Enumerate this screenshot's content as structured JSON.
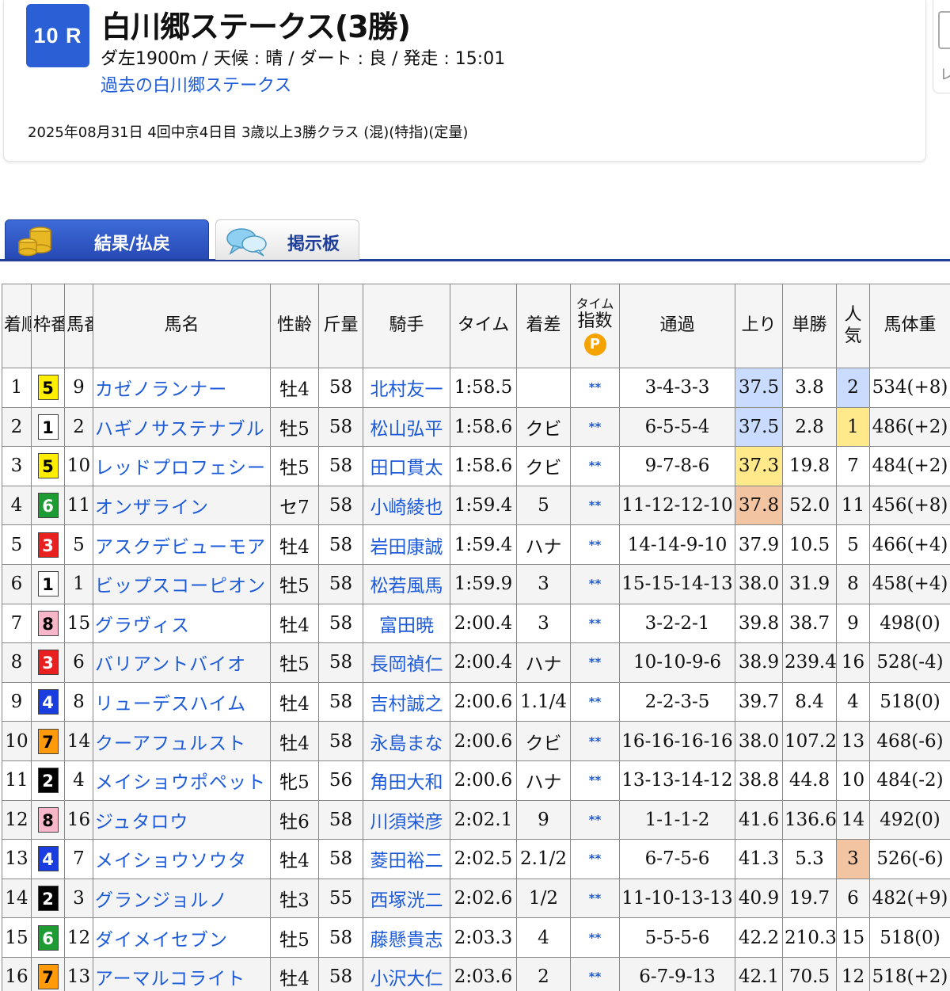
{
  "race": {
    "number": "10 R",
    "title": "白川郷ステークス(3勝)",
    "info": "ダ左1900m /  天候 : 晴 /  ダート : 良  /  発走 : 15:01",
    "past_link": "過去の白川郷ステークス",
    "meta": "2025年08月31日 4回中京4日目 3歳以上3勝クラス  (混)(特指)(定量)"
  },
  "side_card": {
    "text": "レ"
  },
  "tabs": [
    {
      "label": "結果/払戻",
      "icon": "coin-stack-icon"
    },
    {
      "label": "掲示板",
      "icon": "chat-bubbles-icon"
    }
  ],
  "table": {
    "headers": {
      "rank": "着順",
      "frame": "枠番",
      "num": "馬番",
      "name": "馬名",
      "sexage": "性齢",
      "weight": "斤量",
      "jockey": "騎手",
      "time": "タイム",
      "margin": "着差",
      "index_top": "タイム",
      "index_bottom": "指数",
      "index_icon": "P",
      "passing": "通過",
      "last3f": "上り",
      "odds": "単勝",
      "pop": "人気",
      "bodyweight": "馬体重"
    },
    "frame_colors": {
      "1": {
        "bg": "#ffffff",
        "fg": "#000000"
      },
      "2": {
        "bg": "#000000",
        "fg": "#ffffff"
      },
      "3": {
        "bg": "#e8201f",
        "fg": "#ffffff"
      },
      "4": {
        "bg": "#1a3de0",
        "fg": "#ffffff"
      },
      "5": {
        "bg": "#ffee00",
        "fg": "#000000"
      },
      "6": {
        "bg": "#1f9b34",
        "fg": "#ffffff"
      },
      "7": {
        "bg": "#ff9a0a",
        "fg": "#000000"
      },
      "8": {
        "bg": "#f8b7c8",
        "fg": "#000000"
      }
    },
    "rows": [
      {
        "rank": "1",
        "frame": "5",
        "num": "9",
        "name": "カゼノランナー",
        "sexage": "牡4",
        "weight": "58",
        "jockey": "北村友一",
        "time": "1:58.5",
        "margin": "",
        "index": "**",
        "passing": "3-4-3-3",
        "last3f": "37.5",
        "last3f_hl": "blue",
        "odds": "3.8",
        "pop": "2",
        "pop_hl": "blue",
        "bodyweight": "534(+8)"
      },
      {
        "rank": "2",
        "frame": "1",
        "num": "2",
        "name": "ハギノサステナブル",
        "sexage": "牡5",
        "weight": "58",
        "jockey": "松山弘平",
        "time": "1:58.6",
        "margin": "クビ",
        "index": "**",
        "passing": "6-5-5-4",
        "last3f": "37.5",
        "last3f_hl": "blue",
        "odds": "2.8",
        "pop": "1",
        "pop_hl": "yellow",
        "bodyweight": "486(+2)"
      },
      {
        "rank": "3",
        "frame": "5",
        "num": "10",
        "name": "レッドプロフェシー",
        "sexage": "牡5",
        "weight": "58",
        "jockey": "田口貫太",
        "time": "1:58.6",
        "margin": "クビ",
        "index": "**",
        "passing": "9-7-8-6",
        "last3f": "37.3",
        "last3f_hl": "yellow",
        "odds": "19.8",
        "pop": "7",
        "pop_hl": "",
        "bodyweight": "484(+2)"
      },
      {
        "rank": "4",
        "frame": "6",
        "num": "11",
        "name": "オンザライン",
        "sexage": "セ7",
        "weight": "58",
        "jockey": "小崎綾也",
        "time": "1:59.4",
        "margin": "5",
        "index": "**",
        "passing": "11-12-12-10",
        "last3f": "37.8",
        "last3f_hl": "orange",
        "odds": "52.0",
        "pop": "11",
        "pop_hl": "",
        "bodyweight": "456(+8)"
      },
      {
        "rank": "5",
        "frame": "3",
        "num": "5",
        "name": "アスクデビューモア",
        "sexage": "牡4",
        "weight": "58",
        "jockey": "岩田康誠",
        "time": "1:59.4",
        "margin": "ハナ",
        "index": "**",
        "passing": "14-14-9-10",
        "last3f": "37.9",
        "last3f_hl": "",
        "odds": "10.5",
        "pop": "5",
        "pop_hl": "",
        "bodyweight": "466(+4)"
      },
      {
        "rank": "6",
        "frame": "1",
        "num": "1",
        "name": "ビップスコーピオン",
        "sexage": "牡5",
        "weight": "58",
        "jockey": "松若風馬",
        "time": "1:59.9",
        "margin": "3",
        "index": "**",
        "passing": "15-15-14-13",
        "last3f": "38.0",
        "last3f_hl": "",
        "odds": "31.9",
        "pop": "8",
        "pop_hl": "",
        "bodyweight": "458(+4)"
      },
      {
        "rank": "7",
        "frame": "8",
        "num": "15",
        "name": "グラヴィス",
        "sexage": "牡4",
        "weight": "58",
        "jockey": "富田暁",
        "time": "2:00.4",
        "margin": "3",
        "index": "**",
        "passing": "3-2-2-1",
        "last3f": "39.8",
        "last3f_hl": "",
        "odds": "38.7",
        "pop": "9",
        "pop_hl": "",
        "bodyweight": "498(0)"
      },
      {
        "rank": "8",
        "frame": "3",
        "num": "6",
        "name": "バリアントバイオ",
        "sexage": "牡5",
        "weight": "58",
        "jockey": "長岡禎仁",
        "time": "2:00.4",
        "margin": "ハナ",
        "index": "**",
        "passing": "10-10-9-6",
        "last3f": "38.9",
        "last3f_hl": "",
        "odds": "239.4",
        "pop": "16",
        "pop_hl": "",
        "bodyweight": "528(-4)"
      },
      {
        "rank": "9",
        "frame": "4",
        "num": "8",
        "name": "リューデスハイム",
        "sexage": "牡4",
        "weight": "58",
        "jockey": "吉村誠之",
        "time": "2:00.6",
        "margin": "1.1/4",
        "index": "**",
        "passing": "2-2-3-5",
        "last3f": "39.7",
        "last3f_hl": "",
        "odds": "8.4",
        "pop": "4",
        "pop_hl": "",
        "bodyweight": "518(0)"
      },
      {
        "rank": "10",
        "frame": "7",
        "num": "14",
        "name": "クーアフュルスト",
        "sexage": "牡4",
        "weight": "58",
        "jockey": "永島まな",
        "time": "2:00.6",
        "margin": "クビ",
        "index": "**",
        "passing": "16-16-16-16",
        "last3f": "38.0",
        "last3f_hl": "",
        "odds": "107.2",
        "pop": "13",
        "pop_hl": "",
        "bodyweight": "468(-6)"
      },
      {
        "rank": "11",
        "frame": "2",
        "num": "4",
        "name": "メイショウポペット",
        "sexage": "牝5",
        "weight": "56",
        "jockey": "角田大和",
        "time": "2:00.6",
        "margin": "ハナ",
        "index": "**",
        "passing": "13-13-14-12",
        "last3f": "38.8",
        "last3f_hl": "",
        "odds": "44.8",
        "pop": "10",
        "pop_hl": "",
        "bodyweight": "484(-2)"
      },
      {
        "rank": "12",
        "frame": "8",
        "num": "16",
        "name": "ジュタロウ",
        "sexage": "牡6",
        "weight": "58",
        "jockey": "川須栄彦",
        "time": "2:02.1",
        "margin": "9",
        "index": "**",
        "passing": "1-1-1-2",
        "last3f": "41.6",
        "last3f_hl": "",
        "odds": "136.6",
        "pop": "14",
        "pop_hl": "",
        "bodyweight": "492(0)"
      },
      {
        "rank": "13",
        "frame": "4",
        "num": "7",
        "name": "メイショウソウタ",
        "sexage": "牡4",
        "weight": "58",
        "jockey": "菱田裕二",
        "time": "2:02.5",
        "margin": "2.1/2",
        "index": "**",
        "passing": "6-7-5-6",
        "last3f": "41.3",
        "last3f_hl": "",
        "odds": "5.3",
        "pop": "3",
        "pop_hl": "orange",
        "bodyweight": "526(-6)"
      },
      {
        "rank": "14",
        "frame": "2",
        "num": "3",
        "name": "グランジョルノ",
        "sexage": "牡3",
        "weight": "55",
        "jockey": "西塚洸二",
        "time": "2:02.6",
        "margin": "1/2",
        "index": "**",
        "passing": "11-10-13-13",
        "last3f": "40.9",
        "last3f_hl": "",
        "odds": "19.7",
        "pop": "6",
        "pop_hl": "",
        "bodyweight": "482(+9)"
      },
      {
        "rank": "15",
        "frame": "6",
        "num": "12",
        "name": "ダイメイセブン",
        "sexage": "牡5",
        "weight": "58",
        "jockey": "藤懸貴志",
        "time": "2:03.3",
        "margin": "4",
        "index": "**",
        "passing": "5-5-5-6",
        "last3f": "42.2",
        "last3f_hl": "",
        "odds": "210.3",
        "pop": "15",
        "pop_hl": "",
        "bodyweight": "518(0)"
      },
      {
        "rank": "16",
        "frame": "7",
        "num": "13",
        "name": "アーマルコライト",
        "sexage": "牡4",
        "weight": "58",
        "jockey": "小沢大仁",
        "time": "2:03.6",
        "margin": "2",
        "index": "**",
        "passing": "6-7-9-13",
        "last3f": "42.1",
        "last3f_hl": "",
        "odds": "70.5",
        "pop": "12",
        "pop_hl": "",
        "bodyweight": "518(+2)"
      }
    ]
  }
}
